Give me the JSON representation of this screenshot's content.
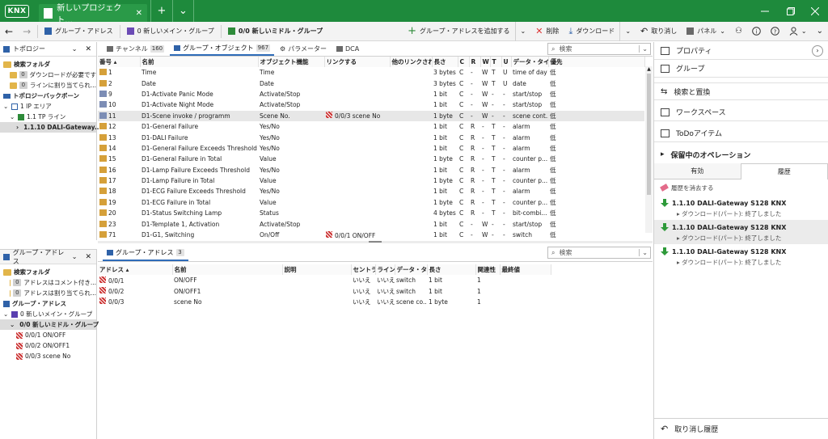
{
  "titlebar": {
    "logo": "KNX",
    "tab_title": "新しいプロジェクト...",
    "tab_close": "✕",
    "add_tab": "+",
    "menu": "⌄"
  },
  "toolbar": {
    "breadcrumb_1": "グループ・アドレス",
    "breadcrumb_2": "0 新しいメイン・グループ",
    "breadcrumb_3": "0/0 新しいミドル・グループ",
    "add_ga": "グループ・アドレスを追加する",
    "delete": "削除",
    "download": "ダウンロード",
    "undo": "取り消し",
    "panel": "パネル"
  },
  "topology_panel": {
    "title": "トポロジー",
    "items": [
      {
        "label": "検索フォルダ",
        "indent": 0,
        "style": "bold",
        "icon": "folder"
      },
      {
        "badge": "0",
        "label": "ダウンロードが必要です",
        "indent": 1,
        "icon": "folder"
      },
      {
        "badge": "0",
        "label": "ラインに割り当てられ...",
        "indent": 1,
        "icon": "folder"
      },
      {
        "label": "トポロジーバックボーン",
        "indent": 0,
        "style": "bold",
        "icon": "backbone"
      },
      {
        "label": "1 IP エリア",
        "indent": 0,
        "icon": "area",
        "chevron": "⌄"
      },
      {
        "label": "1.1 TP ライン",
        "indent": 1,
        "icon": "line",
        "chevron": "⌄"
      },
      {
        "label": "1.1.10 DALI-Gateway...",
        "indent": 2,
        "icon": "device",
        "chevron": "›",
        "style": "sel"
      }
    ]
  },
  "ga_panel": {
    "title": "グループ・アドレス",
    "items": [
      {
        "label": "検索フォルダ",
        "indent": 0,
        "style": "bold",
        "icon": "folder"
      },
      {
        "badge": "0",
        "label": "アドレスはコメント付き...",
        "indent": 1,
        "icon": "folder"
      },
      {
        "badge": "0",
        "label": "アドレスは割り当てられ...",
        "indent": 1,
        "icon": "folder"
      },
      {
        "label": "グループ・アドレス",
        "indent": 0,
        "style": "bold",
        "icon": "garoot"
      },
      {
        "label": "0 新しいメイン・グループ",
        "indent": 0,
        "icon": "main",
        "chevron": "⌄"
      },
      {
        "label": "0/0 新しいミドル・グループ",
        "indent": 1,
        "icon": "mid",
        "chevron": "⌄",
        "style": "sel"
      },
      {
        "label": "0/0/1 ON/OFF",
        "indent": 2,
        "icon": "ga"
      },
      {
        "label": "0/0/2 ON/OFF1",
        "indent": 2,
        "icon": "ga"
      },
      {
        "label": "0/0/3 scene No",
        "indent": 2,
        "icon": "ga"
      }
    ]
  },
  "top_tabs": {
    "channel": "チャンネル",
    "channel_count": "160",
    "group_objects": "グループ・オブジェクト",
    "group_objects_count": "967",
    "parameters": "パラメーター",
    "dca": "DCA",
    "search_placeholder": "検索"
  },
  "objects_table": {
    "columns": [
      "番号 ▴",
      "名前",
      "オブジェクト機能",
      "リンクする",
      "他のリンクされた",
      "長さ",
      "C",
      "R",
      "W",
      "T",
      "U",
      "データ・タイプ",
      "優先"
    ],
    "rows": [
      [
        "1",
        "Time",
        "Time",
        "",
        "",
        "3 bytes",
        "C",
        "-",
        "W",
        "T",
        "U",
        "time of day",
        "低"
      ],
      [
        "2",
        "Date",
        "Date",
        "",
        "",
        "3 bytes",
        "C",
        "-",
        "W",
        "T",
        "U",
        "date",
        "低"
      ],
      [
        "9",
        "D1-Activate Panic Mode",
        "Activate/Stop",
        "",
        "",
        "1 bit",
        "C",
        "-",
        "W",
        "-",
        "-",
        "start/stop",
        "低"
      ],
      [
        "10",
        "D1-Activate Night Mode",
        "Activate/Stop",
        "",
        "",
        "1 bit",
        "C",
        "-",
        "W",
        "-",
        "-",
        "start/stop",
        "低"
      ],
      [
        "11",
        "D1-Scene invoke / programm",
        "Scene No.",
        "0/0/3 scene No",
        "",
        "1 byte",
        "C",
        "-",
        "W",
        "-",
        "-",
        "scene cont...",
        "低"
      ],
      [
        "12",
        "D1-General Failure",
        "Yes/No",
        "",
        "",
        "1 bit",
        "C",
        "R",
        "-",
        "T",
        "-",
        "alarm",
        "低"
      ],
      [
        "13",
        "D1-DALI Failure",
        "Yes/No",
        "",
        "",
        "1 bit",
        "C",
        "R",
        "-",
        "T",
        "-",
        "alarm",
        "低"
      ],
      [
        "14",
        "D1-General Failure Exceeds Threshold",
        "Yes/No",
        "",
        "",
        "1 bit",
        "C",
        "R",
        "-",
        "T",
        "-",
        "alarm",
        "低"
      ],
      [
        "15",
        "D1-General Failure in Total",
        "Value",
        "",
        "",
        "1 byte",
        "C",
        "R",
        "-",
        "T",
        "-",
        "counter p...",
        "低"
      ],
      [
        "16",
        "D1-Lamp Failure Exceeds Threshold",
        "Yes/No",
        "",
        "",
        "1 bit",
        "C",
        "R",
        "-",
        "T",
        "-",
        "alarm",
        "低"
      ],
      [
        "17",
        "D1-Lamp Failure in Total",
        "Value",
        "",
        "",
        "1 byte",
        "C",
        "R",
        "-",
        "T",
        "-",
        "counter p...",
        "低"
      ],
      [
        "18",
        "D1-ECG Failure Exceeds Threshold",
        "Yes/No",
        "",
        "",
        "1 bit",
        "C",
        "R",
        "-",
        "T",
        "-",
        "alarm",
        "低"
      ],
      [
        "19",
        "D1-ECG Failure in Total",
        "Value",
        "",
        "",
        "1 byte",
        "C",
        "R",
        "-",
        "T",
        "-",
        "counter p...",
        "低"
      ],
      [
        "20",
        "D1-Status Switching Lamp",
        "Status",
        "",
        "",
        "4 bytes",
        "C",
        "R",
        "-",
        "T",
        "-",
        "bit-combi...",
        "低"
      ],
      [
        "23",
        "D1-Template 1, Activation",
        "Activate/Stop",
        "",
        "",
        "1 bit",
        "C",
        "-",
        "W",
        "-",
        "-",
        "start/stop",
        "低"
      ],
      [
        "71",
        "D1-G1, Switching",
        "On/Off",
        "0/0/1 ON/OFF",
        "",
        "1 bit",
        "C",
        "-",
        "W",
        "-",
        "-",
        "switch",
        "低"
      ]
    ]
  },
  "bottom_tabs": {
    "group_addresses": "グループ・アドレス",
    "group_addresses_count": "3",
    "search_placeholder": "検索"
  },
  "ga_table": {
    "columns": [
      "アドレス ▴",
      "名前",
      "説明",
      "セントラ",
      "ライン・",
      "データ・タイプ",
      "長さ",
      "関連性",
      "最終値"
    ],
    "rows": [
      [
        "0/0/1",
        "ON/OFF",
        "",
        "いいえ",
        "いいえ",
        "switch",
        "1 bit",
        "1",
        ""
      ],
      [
        "0/0/2",
        "ON/OFF1",
        "",
        "いいえ",
        "いいえ",
        "switch",
        "1 bit",
        "1",
        ""
      ],
      [
        "0/0/3",
        "scene No",
        "",
        "いいえ",
        "いいえ",
        "scene co...",
        "1 byte",
        "1",
        ""
      ]
    ]
  },
  "right_panel": {
    "properties": "プロパティ",
    "groups": "グループ",
    "search_replace": "検索と置換",
    "workspace": "ワークスペース",
    "todo": "ToDoアイテム",
    "pending": "保留中のオペレーション",
    "tab_valid": "有効",
    "tab_history": "履歴",
    "clear_history": "履歴を消去する",
    "history": [
      {
        "title": "1.1.10 DALI-Gateway S128 KNX",
        "detail": "ダウンロード(パート): 終了しました"
      },
      {
        "title": "1.1.10 DALI-Gateway S128 KNX",
        "detail": "ダウンロード(パート): 終了しました"
      },
      {
        "title": "1.1.10 DALI-Gateway S128 KNX",
        "detail": "ダウンロード(パート): 終了しました"
      }
    ],
    "undo_history": "取り消し履歴"
  }
}
